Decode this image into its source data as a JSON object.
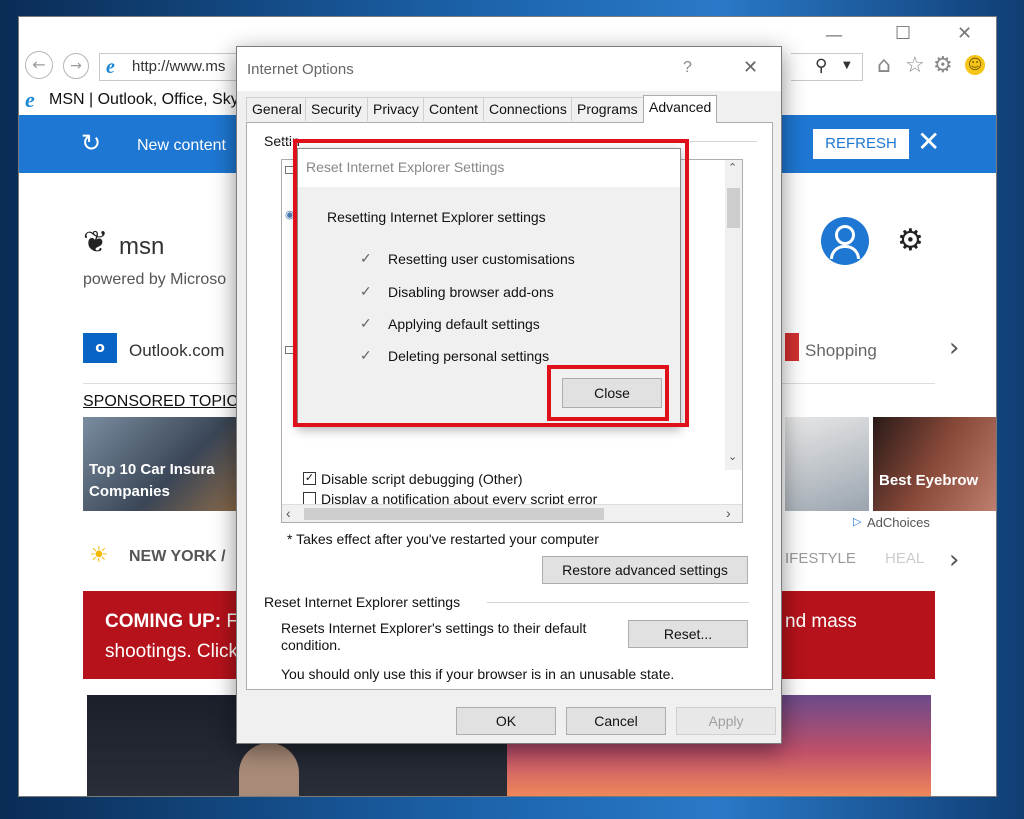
{
  "browser": {
    "address": "http://www.ms",
    "tab_title": "MSN | Outlook, Office, Sky",
    "search_icon": "search-icon",
    "blue_bar": {
      "message": "New content",
      "refresh": "REFRESH"
    },
    "msn": {
      "logo": "msn",
      "powered": "powered by Microso",
      "outlook": "Outlook.com",
      "shopping": "Shopping"
    },
    "sponsored": "SPONSORED TOPIC",
    "car_caption": "Top 10 Car Insura\nCompanies",
    "eyebrow_caption": "Best Eyebrow",
    "adchoices": "AdChoices",
    "weather": "NEW YORK /",
    "lifestyle": "IFESTYLE",
    "health": "HEAL",
    "coming_up": {
      "label": "COMING UP:",
      "text1": "F",
      "text2": "shootings. Click",
      "right": "nd mass"
    }
  },
  "dialog": {
    "title": "Internet Options",
    "help": "?",
    "close": "✕",
    "tabs": [
      "General",
      "Security",
      "Privacy",
      "Content",
      "Connections",
      "Programs",
      "Advanced"
    ],
    "settings_label": "Settin",
    "visible_items": [
      {
        "checked": true,
        "label": "Disable script debugging (Other)"
      },
      {
        "checked": false,
        "label": "Display a notification about every script error"
      }
    ],
    "note": "* Takes effect after you've restarted your computer",
    "restore_button": "Restore advanced settings",
    "reset_section_title": "Reset Internet Explorer settings",
    "reset_description": "Resets Internet Explorer's settings to their default condition.",
    "reset_description_line1": "Resets Internet Explorer's settings to their default",
    "reset_description_line2": "condition.",
    "reset_button": "Reset...",
    "warning": "You should only use this if your browser is in an unusable state.",
    "ok": "OK",
    "cancel": "Cancel",
    "apply": "Apply"
  },
  "reset_dialog": {
    "title": "Reset Internet Explorer Settings",
    "heading": "Resetting Internet Explorer settings",
    "steps": [
      "Resetting user customisations",
      "Disabling browser add-ons",
      "Applying default settings",
      "Deleting personal settings"
    ],
    "check_mark": "✓",
    "close_button": "Close"
  },
  "colors": {
    "highlight": "#e0101a",
    "ie_blue": "#1e77d2",
    "banner_red": "#b6121b"
  }
}
